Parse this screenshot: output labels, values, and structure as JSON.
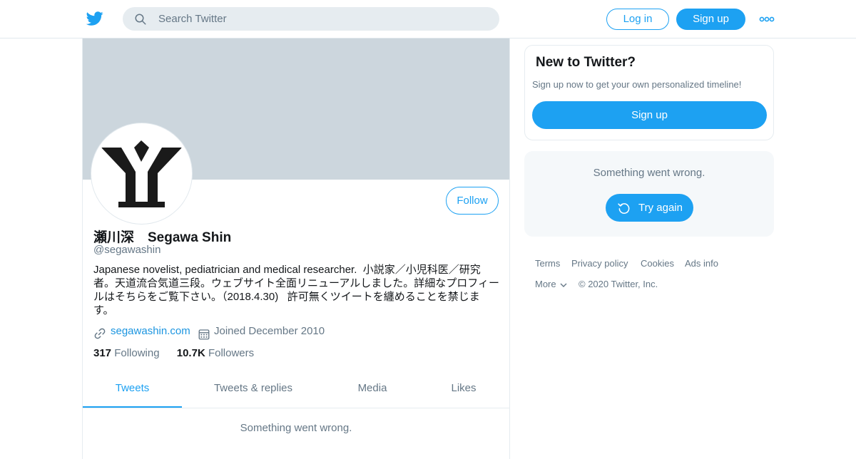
{
  "colors": {
    "accent": "#1da1f2",
    "link": "#1b95e0",
    "secondary_text": "#657786",
    "banner": "#ccd6dd",
    "panel_bg": "#f5f8fa"
  },
  "header": {
    "logo_icon": "twitter-bird-icon",
    "search": {
      "placeholder": "Search Twitter",
      "icon": "search-icon"
    },
    "login_label": "Log in",
    "signup_label": "Sign up",
    "more_icon": "more-dots-icon"
  },
  "profile": {
    "display_name": "瀬川深　Segawa Shin",
    "handle": "@segawashin",
    "bio": "Japanese novelist, pediatrician and medical researcher.  小説家／小児科医／研究者。天道流合気道三段。ウェブサイト全面リニューアルしました。詳細なプロフィールはそちらをご覧下さい。（2018.4.30)   許可無くツイートを纏めることを禁じます。",
    "website": "segawashin.com",
    "joined": "Joined December 2010",
    "following_count": "317",
    "following_label": "Following",
    "followers_count": "10.7K",
    "followers_label": "Followers",
    "follow_label": "Follow"
  },
  "tabs": [
    {
      "label": "Tweets",
      "active": true
    },
    {
      "label": "Tweets & replies",
      "active": false
    },
    {
      "label": "Media",
      "active": false
    },
    {
      "label": "Likes",
      "active": false
    }
  ],
  "feed": {
    "error_text": "Something went wrong."
  },
  "sidebar": {
    "signup_card": {
      "title": "New to Twitter?",
      "subtitle": "Sign up now to get your own personalized timeline!",
      "button_label": "Sign up"
    },
    "error_card": {
      "message": "Something went wrong.",
      "retry_label": "Try again"
    },
    "footer": {
      "links": [
        "Terms",
        "Privacy policy",
        "Cookies",
        "Ads info"
      ],
      "more_label": "More",
      "copyright": "© 2020 Twitter, Inc."
    }
  }
}
